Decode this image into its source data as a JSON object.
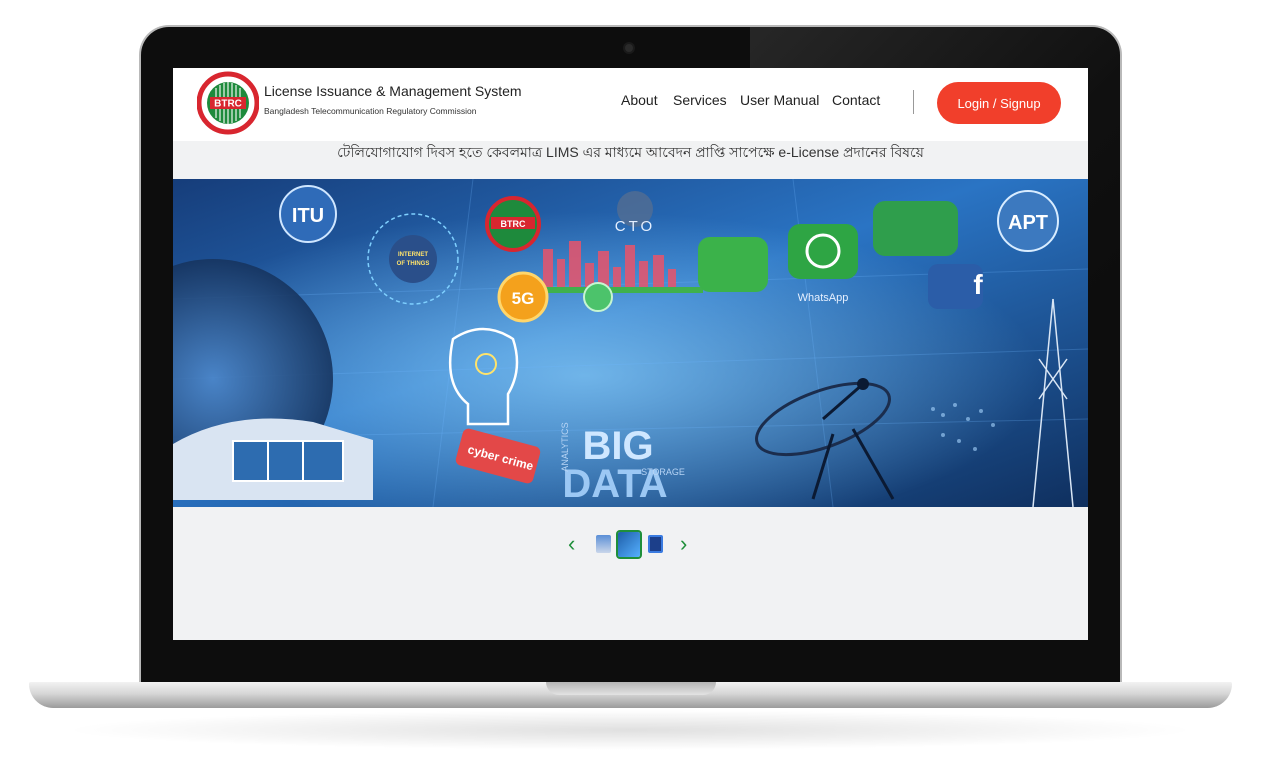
{
  "header": {
    "title": "License Issuance & Management System",
    "subtitle": "Bangladesh Telecommunication Regulatory Commission",
    "logo_text": "BTRC"
  },
  "nav": {
    "about": "About",
    "services": "Services",
    "user_manual": "User Manual",
    "contact": "Contact",
    "login": "Login / Signup"
  },
  "notice": "টেলিযোগাযোগ দিবস হতে কেবলমাত্র LIMS এর মাধ্যমে আবেদন প্রাপ্তি সাপেক্ষে e-License প্রদানের বিষয়ে",
  "banner": {
    "labels": {
      "itu": "ITU",
      "cto": "CTO",
      "apt": "APT",
      "iot": "INTERNET OF THINGS",
      "fiveg": "5G",
      "big": "BIG",
      "data": "DATA",
      "cyber": "cyber crime",
      "whatsapp": "WhatsApp",
      "analytics": "ANALYTICS",
      "storage": "STORAGE",
      "btrc": "BTRC"
    }
  },
  "carousel": {
    "prev": "‹",
    "next": "›",
    "active_index": 1,
    "count": 3
  },
  "colors": {
    "accent": "#f13f2b",
    "arrow": "#1f8f3a",
    "banner_blue": "#1e5ea8"
  }
}
